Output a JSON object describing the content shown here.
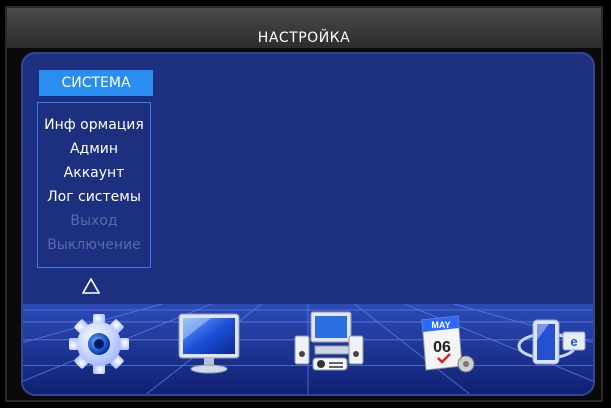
{
  "header": {
    "title": "НАСТРОЙКА"
  },
  "sidebar": {
    "section_label": "СИСТЕМА",
    "items": [
      {
        "label": "Инф ормация",
        "enabled": true
      },
      {
        "label": "Админ",
        "enabled": true
      },
      {
        "label": "Аккаунт",
        "enabled": true
      },
      {
        "label": "Лог системы",
        "enabled": true
      },
      {
        "label": "Выход",
        "enabled": false
      },
      {
        "label": "Выключение",
        "enabled": false
      }
    ],
    "collapse_icon": "triangle-up-icon"
  },
  "dock": {
    "icons": [
      {
        "name": "system-gear-icon"
      },
      {
        "name": "display-monitor-icon"
      },
      {
        "name": "computer-camera-icon"
      },
      {
        "name": "calendar-icon",
        "month": "MAY",
        "day": "06"
      },
      {
        "name": "network-ie-icon"
      }
    ]
  },
  "colors": {
    "panel": "#1d2f7f",
    "accent": "#2a8ef0",
    "disabled_text": "#5a6aa8"
  }
}
